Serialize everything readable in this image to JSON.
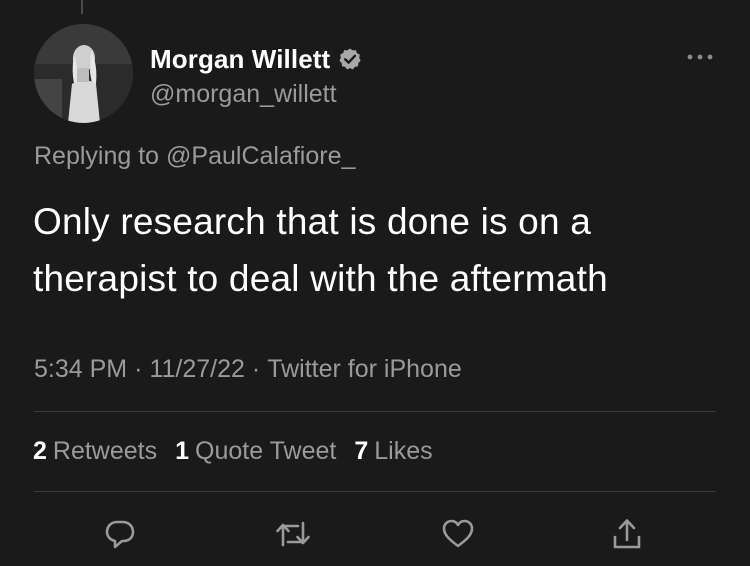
{
  "author": {
    "display_name": "Morgan Willett",
    "handle": "@morgan_willett",
    "verified": true
  },
  "replying": {
    "prefix": "Replying to",
    "mention": "@PaulCalafiore_"
  },
  "tweet": {
    "text": "Only research that is done is on a therapist to deal with the aftermath"
  },
  "meta": {
    "time": "5:34 PM",
    "date": "11/27/22",
    "source": "Twitter for iPhone",
    "separator": "·"
  },
  "stats": {
    "retweets_count": "2",
    "retweets_label": "Retweets",
    "quotes_count": "1",
    "quotes_label": "Quote Tweet",
    "likes_count": "7",
    "likes_label": "Likes"
  },
  "actions": [
    {
      "icon": "reply-icon"
    },
    {
      "icon": "retweet-icon"
    },
    {
      "icon": "like-icon"
    },
    {
      "icon": "share-icon"
    }
  ],
  "colors": {
    "background": "#1a1a1a",
    "primary_text": "#ffffff",
    "secondary_text": "#9a9a9a",
    "divider": "#3a3a3a"
  }
}
